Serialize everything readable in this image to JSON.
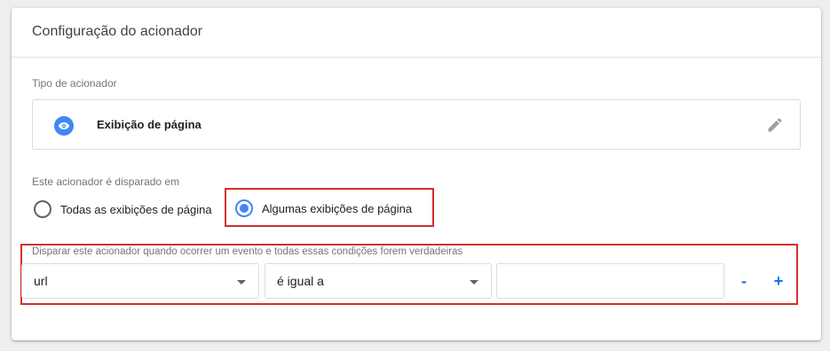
{
  "card": {
    "title": "Configuração do acionador"
  },
  "trigger_type": {
    "label": "Tipo de acionador",
    "name": "Exibição de página",
    "icon": "eye-icon",
    "edit_icon": "pencil-icon"
  },
  "fires_on": {
    "label": "Este acionador é disparado em",
    "options": [
      {
        "label": "Todas as exibições de página",
        "selected": false
      },
      {
        "label": "Algumas exibições de página",
        "selected": true
      }
    ]
  },
  "condition": {
    "label": "Disparar este acionador quando ocorrer um evento e todas essas condições forem verdadeiras",
    "variable": "url",
    "operator": "é igual a",
    "value": "",
    "remove_label": "-",
    "add_label": "+"
  },
  "colors": {
    "accent": "#4285f4",
    "highlight": "#d32f2f",
    "link": "#1a73e8"
  }
}
